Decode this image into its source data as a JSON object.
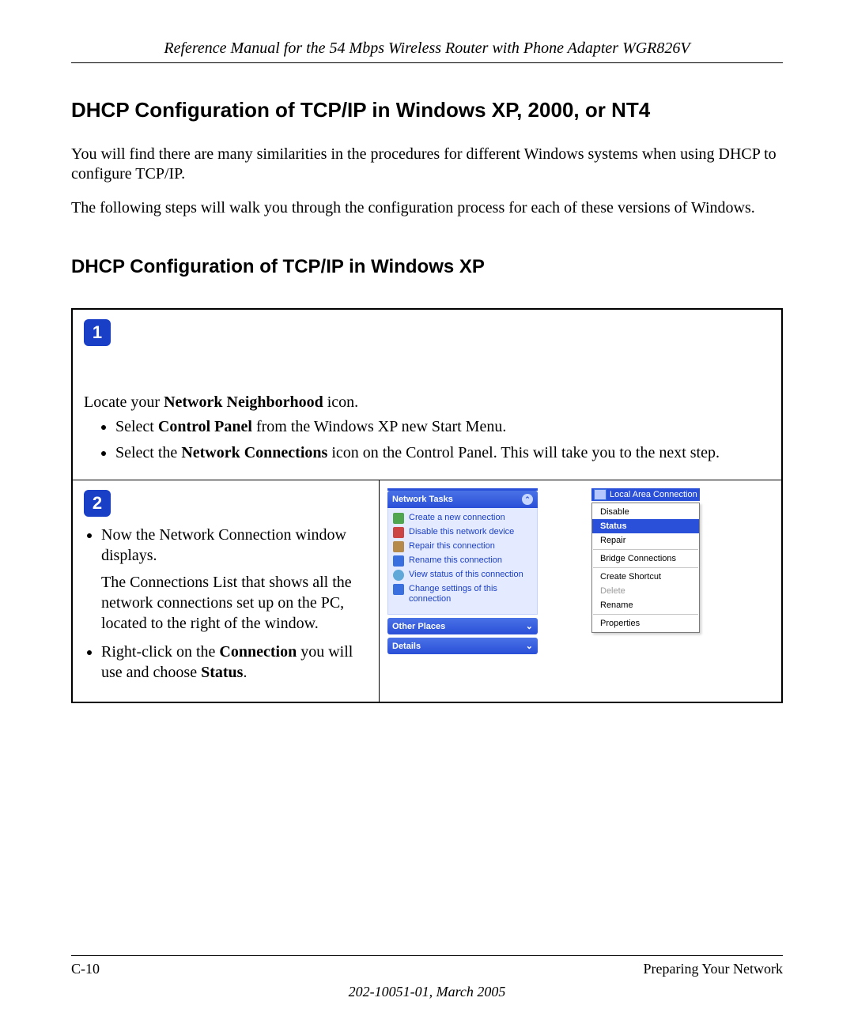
{
  "header": {
    "title": "Reference Manual for the 54 Mbps Wireless Router with Phone Adapter WGR826V"
  },
  "headings": {
    "h2": "DHCP Configuration of TCP/IP in Windows XP, 2000, or NT4",
    "h3": "DHCP Configuration of TCP/IP in Windows XP"
  },
  "para1": "You will find there are many similarities in the procedures for different Windows systems when using DHCP to configure TCP/IP.",
  "para2": "The following steps will walk you through the configuration process for each of these versions of Windows.",
  "step1": {
    "badge": "1",
    "intro_prefix": "Locate your ",
    "intro_bold": "Network Neighborhood",
    "intro_suffix": " icon.",
    "bullet1_prefix": "Select ",
    "bullet1_bold": "Control Panel",
    "bullet1_suffix": " from the Windows XP new Start Menu.",
    "bullet2_prefix": "Select the ",
    "bullet2_bold": "Network Connections",
    "bullet2_suffix": " icon on the Control Panel.  This will take you to the next step."
  },
  "step2": {
    "badge": "2",
    "bullet1": "Now the Network Connection window displays.",
    "sub1": "The Connections List that shows all the network connections set up on the PC, located to the right of the window.",
    "bullet2_prefix": "Right-click on the ",
    "bullet2_bold": "Connection",
    "bullet2_mid": " you will use and choose ",
    "bullet2_bold2": "Status",
    "bullet2_suffix": "."
  },
  "tasks": {
    "header": "Network Tasks",
    "items": [
      "Create a new connection",
      "Disable this network device",
      "Repair this connection",
      "Rename this connection",
      "View status of this connection",
      "Change settings of this connection"
    ],
    "other": "Other Places",
    "details": "Details"
  },
  "conn": {
    "label": "Local Area Connection"
  },
  "ctx": {
    "items": [
      "Disable",
      "Status",
      "Repair",
      "Bridge Connections",
      "Create Shortcut",
      "Delete",
      "Rename",
      "Properties"
    ]
  },
  "footer": {
    "left": "C-10",
    "right": "Preparing Your Network",
    "date": "202-10051-01, March 2005"
  }
}
